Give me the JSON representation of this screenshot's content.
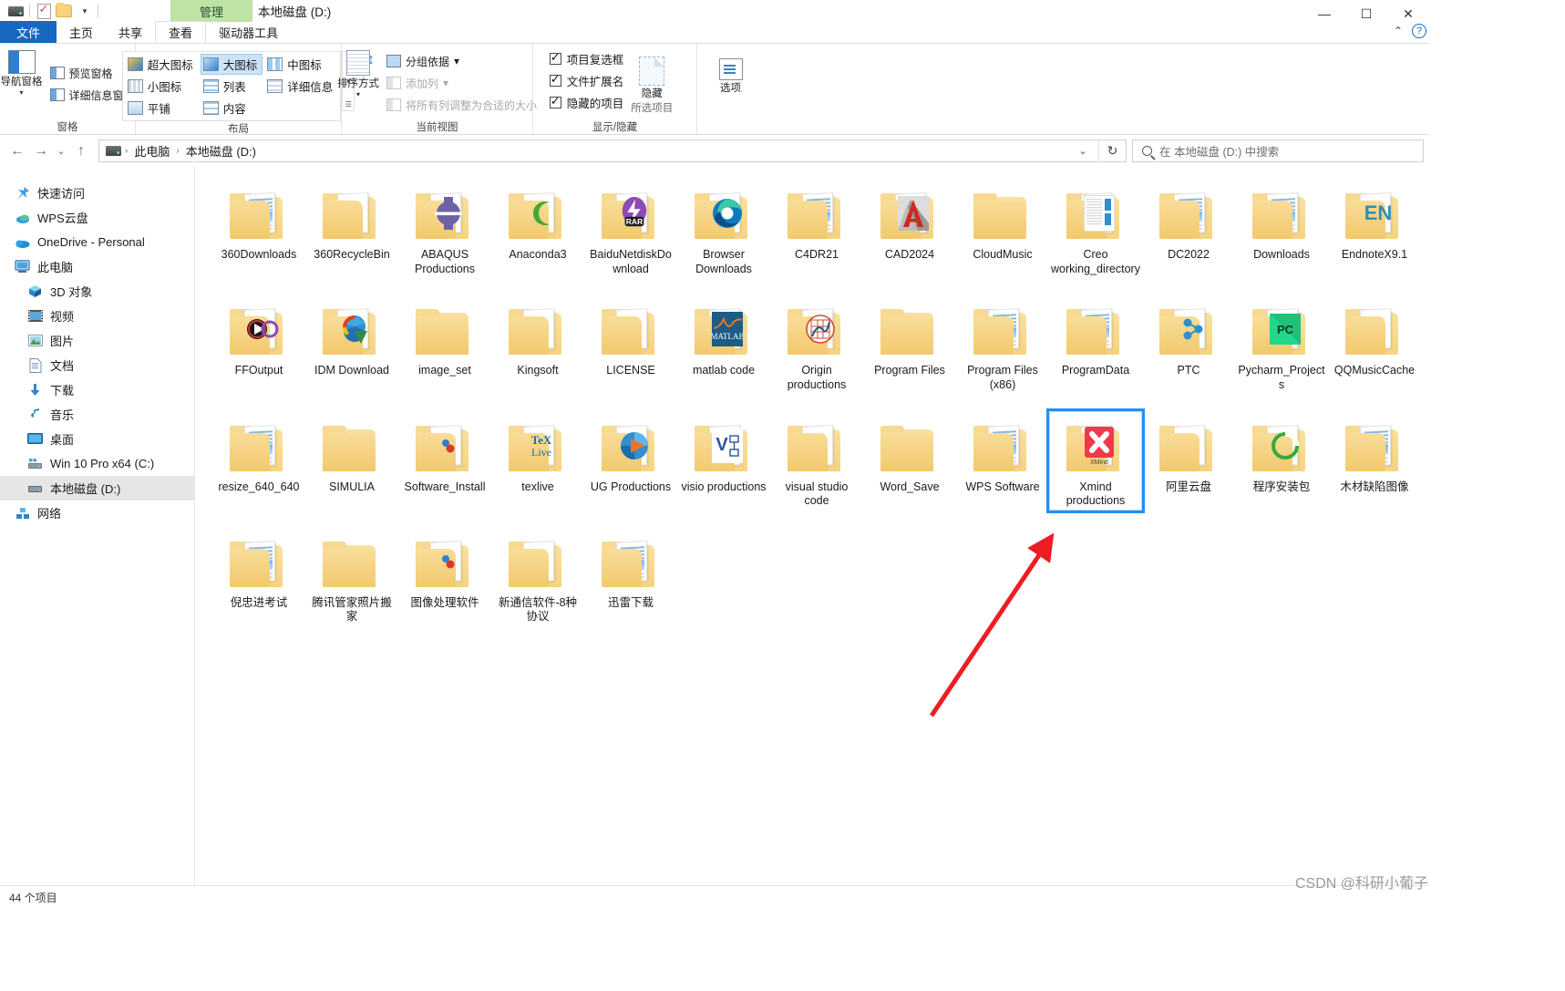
{
  "window": {
    "title": "本地磁盘 (D:)",
    "contextual_tab": "管理",
    "quick_access_icons": [
      "drive-icon",
      "properties-icon",
      "new-folder-icon",
      "customize-caret"
    ],
    "controls": {
      "minimize": "—",
      "maximize": "☐",
      "close": "✕"
    }
  },
  "ribbon_tabs": [
    {
      "label": "文件",
      "style": "file"
    },
    {
      "label": "主页",
      "style": "normal"
    },
    {
      "label": "共享",
      "style": "normal"
    },
    {
      "label": "查看",
      "style": "active"
    },
    {
      "label": "驱动器工具",
      "style": "contextual"
    }
  ],
  "ribbon_right": {
    "collapse": "⌃",
    "help": "?"
  },
  "ribbon": {
    "groups": [
      {
        "name": "窗格",
        "label": "窗格",
        "big_button": {
          "label": "导航窗格",
          "caret": "▾",
          "icon": "nav-pane-icon"
        },
        "small_buttons": [
          {
            "label": "预览窗格",
            "icon": "preview-pane-icon",
            "disabled": false
          },
          {
            "label": "详细信息窗格",
            "icon": "details-pane-icon",
            "disabled": false
          }
        ]
      },
      {
        "name": "布局",
        "label": "布局",
        "views": [
          {
            "label": "超大图标",
            "selected": false
          },
          {
            "label": "大图标",
            "selected": true
          },
          {
            "label": "中图标",
            "selected": false
          },
          {
            "label": "小图标",
            "selected": false
          },
          {
            "label": "列表",
            "selected": false
          },
          {
            "label": "详细信息",
            "selected": false
          },
          {
            "label": "平铺",
            "selected": false
          },
          {
            "label": "内容",
            "selected": false
          }
        ],
        "scroll": {
          "up": "▲",
          "down": "▼",
          "more": "☰"
        }
      },
      {
        "name": "当前视图",
        "label": "当前视图",
        "big_button": {
          "label": "排序方式",
          "caret": "▾",
          "icon": "sort-icon"
        },
        "small_buttons": [
          {
            "label": "分组依据",
            "icon": "group-by-icon",
            "caret": "▾",
            "disabled": false
          },
          {
            "label": "添加列",
            "icon": "add-column-icon",
            "caret": "▾",
            "disabled": true
          },
          {
            "label": "将所有列调整为合适的大小",
            "icon": "fit-columns-icon",
            "disabled": true
          }
        ]
      },
      {
        "name": "显示/隐藏",
        "label": "显示/隐藏",
        "checkboxes": [
          {
            "label": "项目复选框",
            "checked": true
          },
          {
            "label": "文件扩展名",
            "checked": true
          },
          {
            "label": "隐藏的项目",
            "checked": true
          }
        ],
        "hide_button": {
          "label": "隐藏",
          "sub_label": "所选项目",
          "icon": "hide-items-icon"
        }
      },
      {
        "name": "选项",
        "label": "",
        "big_button": {
          "label": "选项",
          "icon": "options-icon"
        }
      }
    ]
  },
  "addressbar": {
    "back": "←",
    "forward": "→",
    "recent": "⌄",
    "up": "↑",
    "drive_icon": "drive-icon",
    "breadcrumbs": [
      "此电脑",
      "本地磁盘 (D:)"
    ],
    "separator": "›",
    "dropdown_caret": "⌄",
    "refresh": "↻"
  },
  "search": {
    "placeholder": "在 本地磁盘 (D:) 中搜索",
    "icon": "search-icon"
  },
  "sidebar": {
    "items": [
      {
        "label": "快速访问",
        "icon": "pin-star-icon",
        "indent": 0,
        "selected": false
      },
      {
        "label": "WPS云盘",
        "icon": "wps-cloud-icon",
        "indent": 0,
        "selected": false
      },
      {
        "label": "OneDrive - Personal",
        "icon": "onedrive-icon",
        "indent": 0,
        "selected": false
      },
      {
        "label": "此电脑",
        "icon": "this-pc-icon",
        "indent": 0,
        "selected": false
      },
      {
        "label": "3D 对象",
        "icon": "3d-objects-icon",
        "indent": 1,
        "selected": false
      },
      {
        "label": "视频",
        "icon": "videos-icon",
        "indent": 1,
        "selected": false
      },
      {
        "label": "图片",
        "icon": "pictures-icon",
        "indent": 1,
        "selected": false
      },
      {
        "label": "文档",
        "icon": "documents-icon",
        "indent": 1,
        "selected": false
      },
      {
        "label": "下载",
        "icon": "downloads-icon",
        "indent": 1,
        "selected": false
      },
      {
        "label": "音乐",
        "icon": "music-icon",
        "indent": 1,
        "selected": false
      },
      {
        "label": "桌面",
        "icon": "desktop-icon",
        "indent": 1,
        "selected": false
      },
      {
        "label": "Win 10 Pro x64 (C:)",
        "icon": "drive-c-icon",
        "indent": 1,
        "selected": false
      },
      {
        "label": "本地磁盘 (D:)",
        "icon": "drive-d-icon",
        "indent": 1,
        "selected": true
      },
      {
        "label": "网络",
        "icon": "network-icon",
        "indent": 0,
        "selected": false
      }
    ]
  },
  "files": [
    {
      "name": "360Downloads",
      "icon": "folder-docs"
    },
    {
      "name": "360RecycleBin",
      "icon": "folder-paper"
    },
    {
      "name": "ABAQUS Productions",
      "icon": "folder-abaqus"
    },
    {
      "name": "Anaconda3",
      "icon": "folder-anaconda"
    },
    {
      "name": "BaiduNetdiskDownload",
      "icon": "folder-winrar"
    },
    {
      "name": "Browser Downloads",
      "icon": "folder-edge"
    },
    {
      "name": "C4DR21",
      "icon": "folder-docs"
    },
    {
      "name": "CAD2024",
      "icon": "folder-autocad"
    },
    {
      "name": "CloudMusic",
      "icon": "folder-empty"
    },
    {
      "name": "Creo working_directory",
      "icon": "folder-creo"
    },
    {
      "name": "DC2022",
      "icon": "folder-docs"
    },
    {
      "name": "Downloads",
      "icon": "folder-docs"
    },
    {
      "name": "EndnoteX9.1",
      "icon": "folder-endnote"
    },
    {
      "name": "FFOutput",
      "icon": "folder-media"
    },
    {
      "name": "IDM Download",
      "icon": "folder-idm"
    },
    {
      "name": "image_set",
      "icon": "folder-empty"
    },
    {
      "name": "Kingsoft",
      "icon": "folder-paper"
    },
    {
      "name": "LICENSE",
      "icon": "folder-paper"
    },
    {
      "name": "matlab code",
      "icon": "folder-matlab"
    },
    {
      "name": "Origin productions",
      "icon": "folder-origin"
    },
    {
      "name": "Program Files",
      "icon": "folder-empty"
    },
    {
      "name": "Program Files (x86)",
      "icon": "folder-docs"
    },
    {
      "name": "ProgramData",
      "icon": "folder-docs"
    },
    {
      "name": "PTC",
      "icon": "folder-ptc"
    },
    {
      "name": "Pycharm_Projects",
      "icon": "folder-pycharm"
    },
    {
      "name": "QQMusicCache",
      "icon": "folder-paper"
    },
    {
      "name": "resize_640_640",
      "icon": "folder-docs"
    },
    {
      "name": "SIMULIA",
      "icon": "folder-empty"
    },
    {
      "name": "Software_Install",
      "icon": "folder-paper-dot"
    },
    {
      "name": "texlive",
      "icon": "folder-tex"
    },
    {
      "name": "UG Productions",
      "icon": "folder-ug"
    },
    {
      "name": "visio productions",
      "icon": "folder-visio"
    },
    {
      "name": "visual studio code",
      "icon": "folder-paper"
    },
    {
      "name": "Word_Save",
      "icon": "folder-empty"
    },
    {
      "name": "WPS Software",
      "icon": "folder-docs"
    },
    {
      "name": "Xmind productions",
      "icon": "folder-xmind",
      "selected": true
    },
    {
      "name": "阿里云盘",
      "icon": "folder-paper"
    },
    {
      "name": "程序安装包",
      "icon": "folder-green"
    },
    {
      "name": "木材缺陷图像",
      "icon": "folder-docs"
    },
    {
      "name": "倪忠进考试",
      "icon": "folder-docs"
    },
    {
      "name": "腾讯管家照片搬家",
      "icon": "folder-empty"
    },
    {
      "name": "图像处理软件",
      "icon": "folder-paper-dot"
    },
    {
      "name": "新通信软件-8种协议",
      "icon": "folder-paper"
    },
    {
      "name": "迅雷下载",
      "icon": "folder-docs"
    }
  ],
  "statusbar": {
    "count_text": "44 个项目"
  },
  "watermark": {
    "text": "CSDN @科研小葡子"
  },
  "colors": {
    "accent": "#1668c1",
    "selection_outline": "#1e90ff",
    "annotation_arrow": "#ee1c25",
    "contextual_tab": "#bfe3a4",
    "folder": "#f7d37a"
  }
}
